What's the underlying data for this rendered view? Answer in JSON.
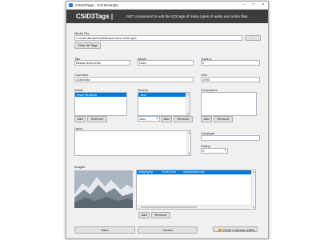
{
  "window": {
    "title": "CSID3Tags - Full Example"
  },
  "banner": {
    "logo": "CSID3Tags |",
    "tagline": ".NET component to edit the ID3 tags of many types of audio and video files."
  },
  "media_file": {
    "label": "Media File",
    "value": "C:\\User\\Music\\Gold\\Bossa Nova USA.mp3",
    "browse_label": "...",
    "clear_label": "Clear All Tags"
  },
  "title": {
    "label": "Title",
    "value": "Bossa Nova USA"
  },
  "album": {
    "label": "Album",
    "value": "Gold"
  },
  "track": {
    "label": "Track #",
    "value": "2"
  },
  "comment": {
    "label": "Comment",
    "value": "c43ph53e"
  },
  "year": {
    "label": "Year",
    "value": "1993"
  },
  "artists": {
    "label": "Artists",
    "items": [
      {
        "text": "Dave Brubeck",
        "selected": true
      }
    ],
    "add_label": "Add",
    "remove_label": "Remove"
  },
  "genres": {
    "label": "Genres",
    "items": [
      {
        "text": "Jazz",
        "selected": true
      }
    ],
    "select_value": "Jazz",
    "add_label": "Add",
    "remove_label": "Remove"
  },
  "composers": {
    "label": "Composers",
    "items": [],
    "add_label": "Add",
    "remove_label": "Remove"
  },
  "lyrics": {
    "label": "Lyrics",
    "value": ""
  },
  "copyright": {
    "label": "Copyright",
    "value": ""
  },
  "rating": {
    "label": "Rating",
    "value": "0"
  },
  "images": {
    "label": "Images",
    "columns": [
      "Image/jpeg",
      "FrontCover",
      "mmmmmdn.com"
    ],
    "add_label": "Add",
    "remove_label": "Remove"
  },
  "footer": {
    "save_label": "Save",
    "cancel_label": "Cancel",
    "license_label": "Order a license online"
  },
  "colors": {
    "banner": "#3d3d3d",
    "selection": "#0078d7"
  }
}
